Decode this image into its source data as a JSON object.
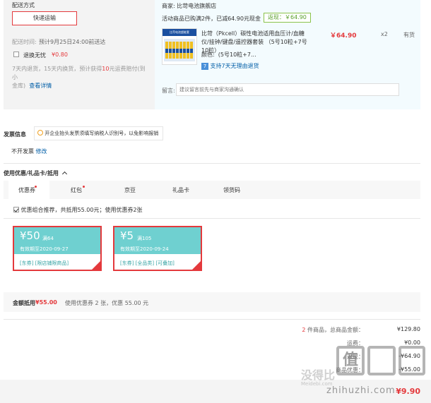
{
  "delivery": {
    "section_title": "配送方式",
    "method_button": "快递运输",
    "time_label": "配送时间:",
    "time_value": "预计9月25日24:00前送达",
    "worry_free_label": "退换无忧",
    "worry_free_price": "¥0.80",
    "worry_free_desc_1": "7天内退货，15天内换货，预计获得",
    "worry_free_desc_num": "10",
    "worry_free_desc_2": "元运费赔付(到小",
    "worry_free_desc_3": "金库)",
    "worry_free_link": "查看详情"
  },
  "shop": {
    "merchant_label": "商家:",
    "merchant_name": "比苛电池旗舰店",
    "promo_text": "活动商品已购满2件，已减64.90元现金",
    "rebate_badge": "返现：￥64.90",
    "product": {
      "title": "比苛（Pkcell）碳性电池适用血压计/血糖仪/挂钟/键盘/遥控器套装 （5号10粒+7号10粒）",
      "color_label": "颜色:",
      "color_value": "(5号10粒+7...",
      "return_badge": "7",
      "return_text": "支持7天无理由退货",
      "price": "￥64.90",
      "qty": "x2",
      "stock": "有货",
      "image_banner": "比苛电池超能套"
    },
    "note_label": "留言:",
    "note_placeholder": "建议留言前先与商家沟通确认"
  },
  "invoice": {
    "title": "发票信息",
    "tip": "开企业抬头发票须填写纳税人识别号，以免影响报销",
    "value": "不开发票",
    "edit_link": "修改"
  },
  "discount": {
    "title": "使用优惠/礼品卡/抵用",
    "tabs": [
      "优惠券",
      "红包",
      "京豆",
      "礼品卡",
      "领货码"
    ],
    "combo_text": "优惠组合推荐，共抵用55.00元；使用优惠券2张",
    "coupons": [
      {
        "amount": "¥50",
        "threshold": "满64",
        "expiry": "有效期至2020-09-27",
        "tag1": "[东券]",
        "tag2": "[限店铺限商品]",
        "tag3": ""
      },
      {
        "amount": "¥5",
        "threshold": "满105",
        "expiry": "有效期至2020-09-24",
        "tag1": "[东券]",
        "tag2": "[全品类]",
        "tag3": "[可叠加]"
      }
    ],
    "summary_label": "金额抵用",
    "summary_amount": "¥55.00",
    "summary_detail": "使用优惠券 2 张，优惠 55.00 元"
  },
  "totals": {
    "count": "2",
    "count_label": "件商品，总商品金额：",
    "goods_total": "¥129.80",
    "shipping_label": "运费：",
    "shipping_value": "¥0.00",
    "return_label": "返现：",
    "return_value": "-¥64.90",
    "coupon_label": "商品优惠：",
    "coupon_value": "-¥55.00",
    "due_value": "¥9.90"
  },
  "watermark": {
    "line1": "没得比",
    "line2": "Meidebi.com",
    "line3": "值",
    "line4": "zhihuzhi.com"
  }
}
